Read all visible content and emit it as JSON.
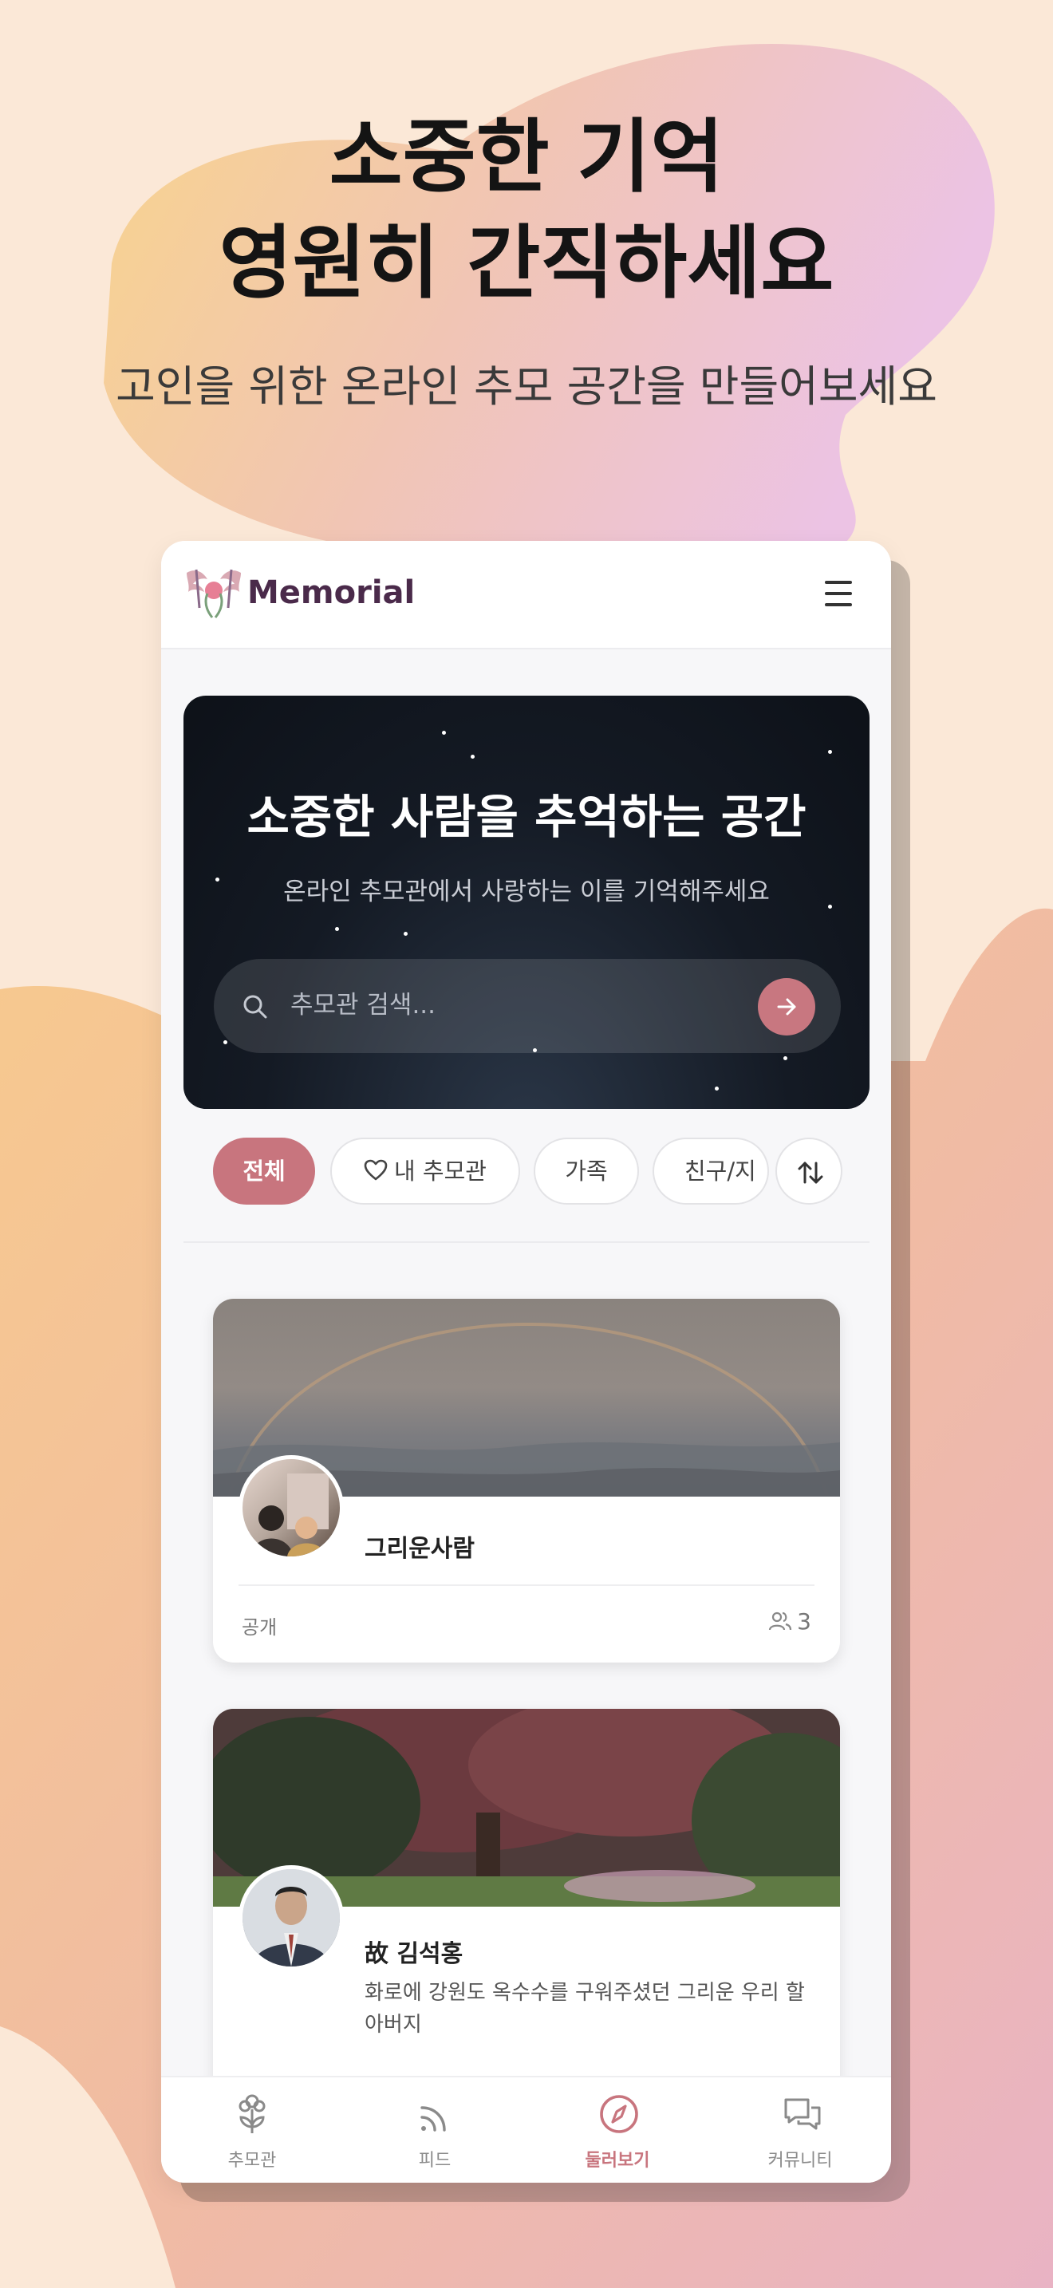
{
  "promo": {
    "title_line1": "소중한 기억",
    "title_line2": "영원히 간직하세요",
    "subtitle": "고인을 위한 온라인 추모 공간을 만들어보세요"
  },
  "app": {
    "brand": "Memorial",
    "accent_color": "#c8757e",
    "banner": {
      "title": "소중한 사람을 추억하는 공간",
      "subtitle": "온라인 추모관에서 사랑하는 이를 기억해주세요",
      "search_placeholder": "추모관 검색..."
    },
    "filters": [
      {
        "label": "전체",
        "active": true
      },
      {
        "label": "내 추모관",
        "icon": "heart-icon",
        "active": false
      },
      {
        "label": "가족",
        "active": false
      },
      {
        "label": "친구/지",
        "active": false
      }
    ],
    "memorials": [
      {
        "name": "그리운사람",
        "description": "",
        "visibility": "공개",
        "visitors": "3"
      },
      {
        "name": "故 김석홍",
        "description": "화로에 강원도 옥수수를 구워주셨던 그리운 우리 할아버지"
      }
    ],
    "tabs": [
      {
        "label": "추모관",
        "icon": "flower-icon",
        "active": false
      },
      {
        "label": "피드",
        "icon": "rss-icon",
        "active": false
      },
      {
        "label": "둘러보기",
        "icon": "compass-icon",
        "active": true
      },
      {
        "label": "커뮤니티",
        "icon": "chat-icon",
        "active": false
      }
    ]
  }
}
